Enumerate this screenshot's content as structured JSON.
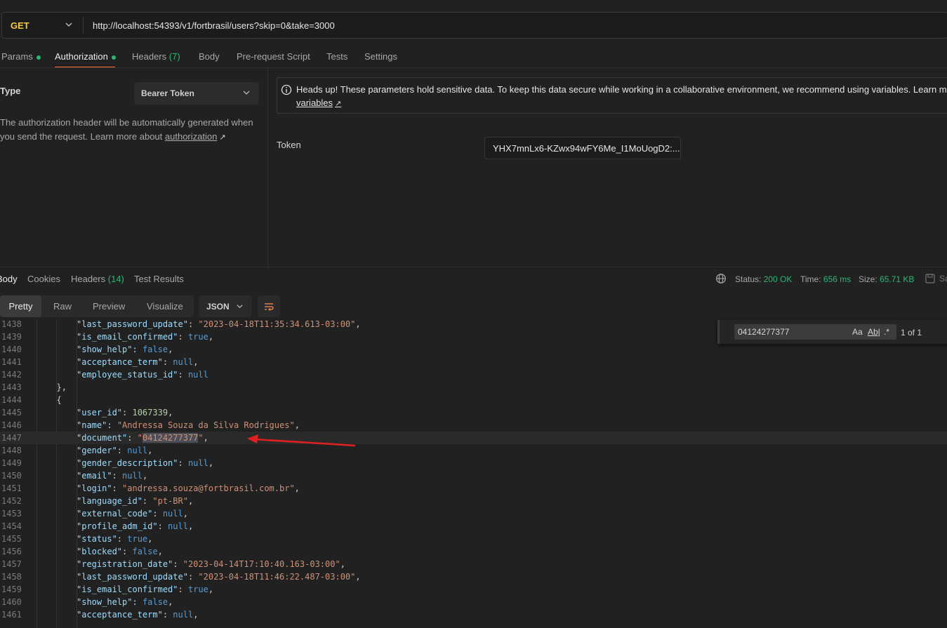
{
  "request": {
    "method": "GET",
    "url": "http://localhost:54393/v1/fortbrasil/users?skip=0&take=3000"
  },
  "request_tabs": [
    {
      "label": "Params"
    },
    {
      "label": "Authorization"
    },
    {
      "label": "Headers"
    },
    {
      "label": "Body"
    },
    {
      "label": "Pre-request Script"
    },
    {
      "label": "Tests"
    },
    {
      "label": "Settings"
    }
  ],
  "headers_count": "(7)",
  "auth": {
    "type_label": "Type",
    "type_value": "Bearer Token",
    "desc": "The authorization header will be automatically generated when you send the request. Learn more about",
    "desc_link": "authorization",
    "heads_up": "Heads up! These parameters hold sensitive data. To keep this data secure while working in a collaborative environment, we recommend using variables. Learn more",
    "heads_up_link": "variables",
    "token_label": "Token",
    "token_value": "YHX7mnLx6-KZwx94wFY6Me_I1MoUogD2:..."
  },
  "response_tabs": [
    {
      "label": "Body"
    },
    {
      "label": "Cookies"
    },
    {
      "label": "Headers"
    },
    {
      "label": "Test Results"
    }
  ],
  "response_headers_count": "(14)",
  "status": {
    "status_label": "Status:",
    "status_value": "200 OK",
    "time_label": "Time:",
    "time_value": "656 ms",
    "size_label": "Size:",
    "size_value": "65.71 KB",
    "save_label": "Sa"
  },
  "view_modes": [
    {
      "label": "Pretty"
    },
    {
      "label": "Raw"
    },
    {
      "label": "Preview"
    },
    {
      "label": "Visualize"
    }
  ],
  "format": "JSON",
  "find": {
    "query": "04124277377",
    "case": "Aa",
    "word": "Ab|",
    "regex": ".*",
    "count": "1 of 1"
  },
  "code_lines": [
    {
      "n": "1438",
      "ind": 3,
      "key": "last_password_update",
      "val": "\"2023-04-18T11:35:34.613-03:00\"",
      "t": "s"
    },
    {
      "n": "1439",
      "ind": 3,
      "key": "is_email_confirmed",
      "val": "true",
      "t": "b"
    },
    {
      "n": "1440",
      "ind": 3,
      "key": "show_help",
      "val": "false",
      "t": "b"
    },
    {
      "n": "1441",
      "ind": 3,
      "key": "acceptance_term",
      "val": "null",
      "t": "b"
    },
    {
      "n": "1442",
      "ind": 3,
      "key": "employee_status_id",
      "val": "null",
      "t": "b",
      "last": true
    },
    {
      "n": "1443",
      "ind": 2,
      "raw": "},"
    },
    {
      "n": "1444",
      "ind": 2,
      "raw": "{"
    },
    {
      "n": "1445",
      "ind": 3,
      "key": "user_id",
      "val": "1067339",
      "t": "n"
    },
    {
      "n": "1446",
      "ind": 3,
      "key": "name",
      "val": "\"Andressa Souza da Silva Rodrigues\"",
      "t": "s"
    },
    {
      "n": "1447",
      "ind": 3,
      "key": "document",
      "val": "\"04124277377\"",
      "t": "s",
      "hl": true
    },
    {
      "n": "1448",
      "ind": 3,
      "key": "gender",
      "val": "null",
      "t": "b"
    },
    {
      "n": "1449",
      "ind": 3,
      "key": "gender_description",
      "val": "null",
      "t": "b"
    },
    {
      "n": "1450",
      "ind": 3,
      "key": "email",
      "val": "null",
      "t": "b"
    },
    {
      "n": "1451",
      "ind": 3,
      "key": "login",
      "val": "\"andressa.souza@fortbrasil.com.br\"",
      "t": "s"
    },
    {
      "n": "1452",
      "ind": 3,
      "key": "language_id",
      "val": "\"pt-BR\"",
      "t": "s"
    },
    {
      "n": "1453",
      "ind": 3,
      "key": "external_code",
      "val": "null",
      "t": "b"
    },
    {
      "n": "1454",
      "ind": 3,
      "key": "profile_adm_id",
      "val": "null",
      "t": "b"
    },
    {
      "n": "1455",
      "ind": 3,
      "key": "status",
      "val": "true",
      "t": "b"
    },
    {
      "n": "1456",
      "ind": 3,
      "key": "blocked",
      "val": "false",
      "t": "b"
    },
    {
      "n": "1457",
      "ind": 3,
      "key": "registration_date",
      "val": "\"2023-04-14T17:10:40.163-03:00\"",
      "t": "s"
    },
    {
      "n": "1458",
      "ind": 3,
      "key": "last_password_update",
      "val": "\"2023-04-18T11:46:22.487-03:00\"",
      "t": "s"
    },
    {
      "n": "1459",
      "ind": 3,
      "key": "is_email_confirmed",
      "val": "true",
      "t": "b"
    },
    {
      "n": "1460",
      "ind": 3,
      "key": "show_help",
      "val": "false",
      "t": "b"
    },
    {
      "n": "1461",
      "ind": 3,
      "key": "acceptance_term",
      "val": "null",
      "t": "b"
    }
  ]
}
